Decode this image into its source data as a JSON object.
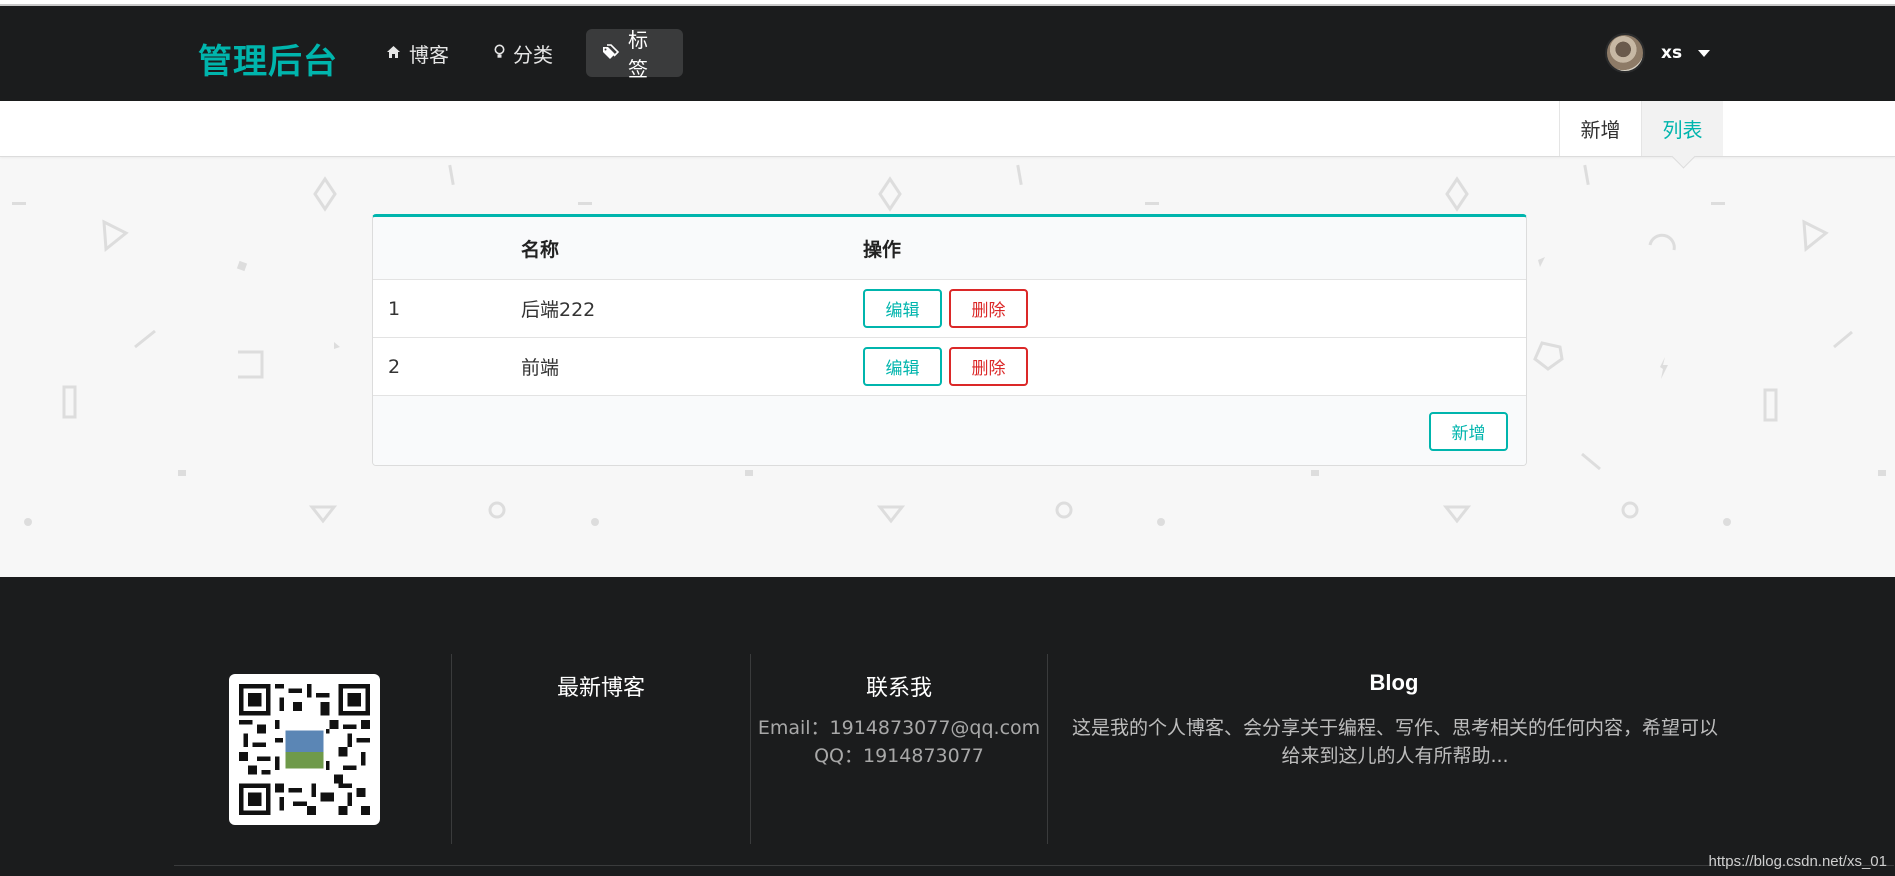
{
  "header": {
    "brand": "管理后台",
    "nav": [
      {
        "label": "博客",
        "icon": "home-icon"
      },
      {
        "label": "分类",
        "icon": "lightbulb-icon"
      },
      {
        "label": "标签",
        "icon": "tags-icon"
      }
    ],
    "active_nav": "标签",
    "user": {
      "name": "xs"
    }
  },
  "submenu": {
    "items": [
      {
        "label": "新增"
      },
      {
        "label": "列表"
      }
    ],
    "active": "列表"
  },
  "table": {
    "headers": [
      "",
      "名称",
      "操作"
    ],
    "rows": [
      {
        "index": "1",
        "name": "后端222",
        "edit_label": "编辑",
        "delete_label": "删除"
      },
      {
        "index": "2",
        "name": "前端",
        "edit_label": "编辑",
        "delete_label": "删除"
      }
    ],
    "add_label": "新增"
  },
  "footer": {
    "latest_title": "最新博客",
    "contact_title": "联系我",
    "email": "Email：1914873077@qq.com",
    "qq": "QQ：1914873077",
    "blog_title": "Blog",
    "blog_desc": "这是我的个人博客、会分享关于编程、写作、思考相关的任何内容，希望可以给来到这儿的人有所帮助..."
  },
  "watermark": "https://blog.csdn.net/xs_01",
  "colors": {
    "accent": "#00b5ad",
    "danger": "#db2828",
    "header_bg": "#1b1c1d"
  }
}
